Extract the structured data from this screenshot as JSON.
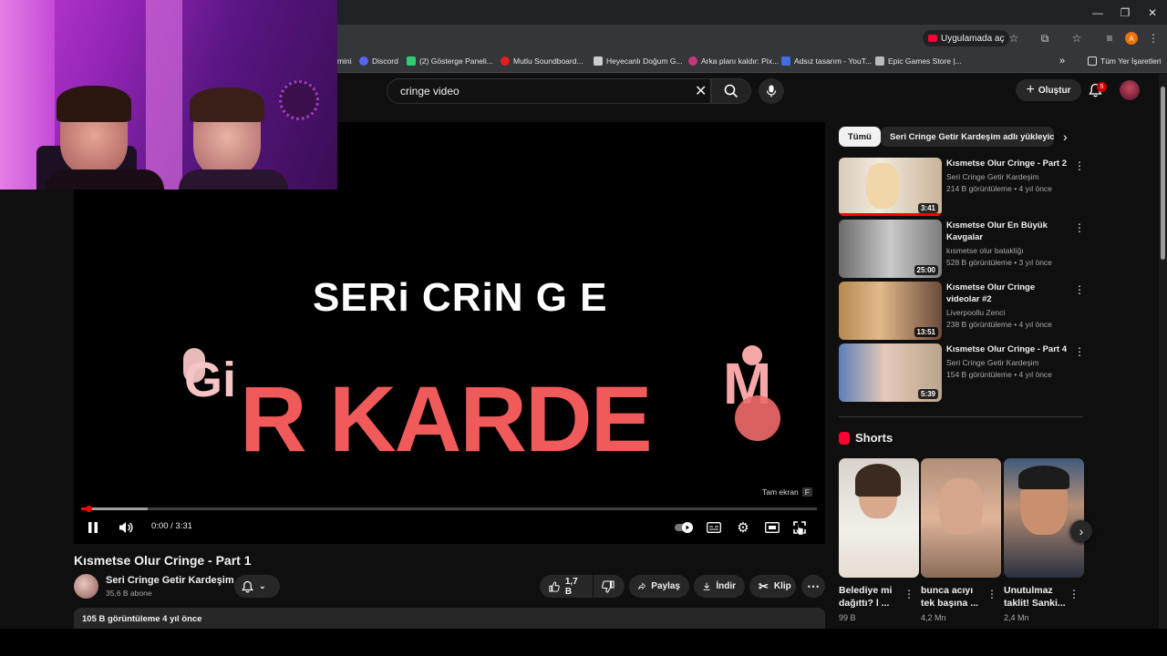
{
  "window": {
    "minimize": "—",
    "restore": "❐",
    "close": "✕"
  },
  "toolbar": {
    "open_in_app": "Uygulamada aç"
  },
  "bookmarks": [
    {
      "label": "mini",
      "color": "#888"
    },
    {
      "label": "Discord",
      "color": "#5865f2"
    },
    {
      "label": "(2) Gösterge Paneli...",
      "color": "#2ecc71"
    },
    {
      "label": "Mutlu Soundboard...",
      "color": "#e01e1e"
    },
    {
      "label": "Heyecanlı Doğum G...",
      "color": "#cccccc"
    },
    {
      "label": "Arka planı kaldır: Pix...",
      "color": "#c0397a"
    },
    {
      "label": "Adsız tasarım - YouT...",
      "color": "#3f6fe0"
    },
    {
      "label": "Epic Games Store |...",
      "color": "#bbbbbb"
    },
    {
      "label": "»",
      "color": ""
    },
    {
      "label": "Tüm Yer İşaretleri",
      "color": ""
    }
  ],
  "masthead": {
    "search_value": "cringe video",
    "create_label": "Oluştur",
    "notif_count": "5"
  },
  "player": {
    "overlay_line1": "SERi CRiN G E",
    "overlay_line2": "R KARDE",
    "overlay_decor_left": "Gi",
    "overlay_decor_right": "M",
    "fullscreen_tooltip": "Tam ekran",
    "fullscreen_key": "F",
    "time": "0:00 / 3:31",
    "progress": 0.01,
    "buffered": 0.09
  },
  "video": {
    "title": "Kısmetse Olur Cringe - Part 1",
    "channel": "Seri Cringe Getir Kardeşim",
    "subs": "35,6 B abone",
    "likes": "1,7 B",
    "share": "Paylaş",
    "download": "İndir",
    "clip": "Klip",
    "desc_meta": "105 B görüntüleme  4 yıl önce"
  },
  "chips": [
    {
      "label": "Tümü"
    },
    {
      "label": "Seri Cringe Getir Kardeşim adlı yükleyiciden"
    }
  ],
  "related": [
    {
      "title": "Kısmetse Olur Cringe - Part 2",
      "channel": "Seri Cringe Getir Kardeşim",
      "meta": "214 B görüntüleme • 4 yıl önce",
      "duration": "3:41",
      "progress": 1.0
    },
    {
      "title": "Kısmetse Olur En Büyük Kavgalar",
      "channel": "kısmetse olur batakliğı",
      "meta": "528 B görüntüleme • 3 yıl önce",
      "duration": "25:00"
    },
    {
      "title": "Kısmetse Olur Cringe videolar #2",
      "channel": "Liverpoollu Zenci",
      "meta": "238 B görüntüleme • 4 yıl önce",
      "duration": "13:51"
    },
    {
      "title": "Kısmetse Olur Cringe - Part 4",
      "channel": "Seri Cringe Getir Kardeşim",
      "meta": "154 B görüntüleme • 4 yıl önce",
      "duration": "5:39"
    }
  ],
  "shorts": {
    "heading": "Shorts",
    "items": [
      {
        "title": "Belediye mi dağıttı? l ...",
        "views": "99 B"
      },
      {
        "title": "bunca acıyı tek başına ...",
        "views": "4,2 Mn"
      },
      {
        "title": "Unutulmaz taklit! Sanki...",
        "views": "2,4 Mn"
      }
    ]
  }
}
